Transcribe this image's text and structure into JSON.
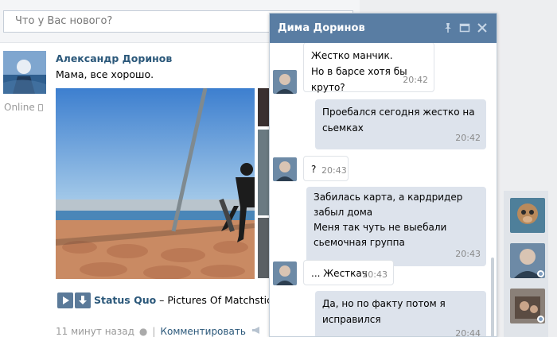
{
  "status": {
    "placeholder": "Что у Вас нового?"
  },
  "post": {
    "author": "Александр Доринов",
    "text": "Мама, все хорошо.",
    "online_label": "Online",
    "audio": {
      "artist": "Status Quo",
      "separator": " – ",
      "song": "Pictures Of Matchstick M"
    },
    "time": "11 минут назад",
    "comment_label": "Комментировать"
  },
  "chat": {
    "title": "Дима Доринов",
    "messages": [
      {
        "dir": "in",
        "lines": [
          "Жестко манчик.",
          "Но в барсе хотя бы круто?"
        ],
        "time": "20:42"
      },
      {
        "dir": "out",
        "lines": [
          "Проебался сегодня жестко на",
          "сьемках"
        ],
        "time": "20:42"
      },
      {
        "dir": "in",
        "lines": [
          "?"
        ],
        "time": "20:43"
      },
      {
        "dir": "out",
        "lines": [
          "Забилась карта, а кардридер",
          "забыл дома",
          "Меня так чуть не выебали",
          "сьемочная группа"
        ],
        "time": "20:43"
      },
      {
        "dir": "in",
        "lines": [
          "... Жесткач"
        ],
        "time": "20:43"
      },
      {
        "dir": "out",
        "lines": [
          "Да, но по факту потом я",
          "исправился"
        ],
        "time": "20:44"
      }
    ]
  },
  "colors": {
    "header_blue": "#597da3",
    "link_blue": "#2b587a",
    "outgoing_bubble": "#dde3ec"
  }
}
